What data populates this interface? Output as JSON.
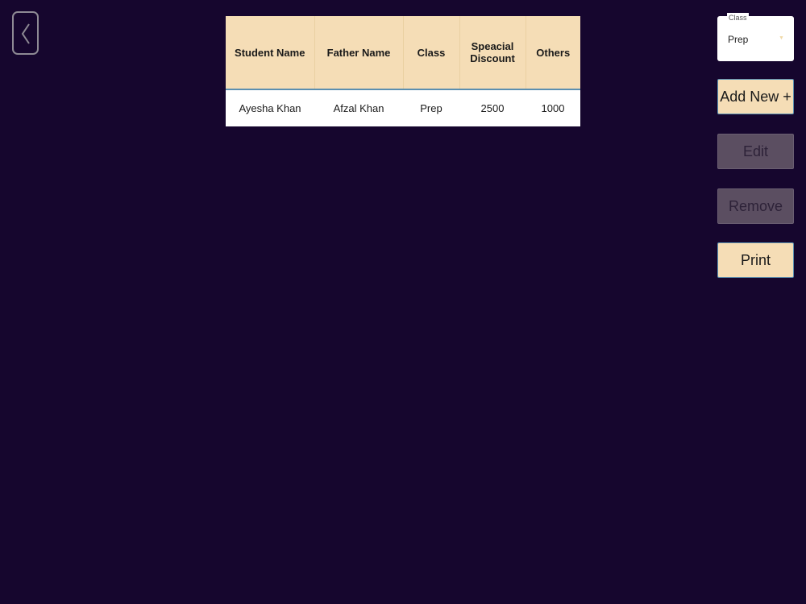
{
  "table": {
    "headers": [
      "Student Name",
      "Father Name",
      "Class",
      "Speacial Discount",
      "Others"
    ],
    "rows": [
      [
        "Ayesha Khan",
        "Afzal Khan",
        "Prep",
        "2500",
        "1000"
      ]
    ]
  },
  "class_filter": {
    "label": "Class",
    "value": "Prep"
  },
  "actions": {
    "add_new": "Add New +",
    "edit": "Edit",
    "remove": "Remove",
    "print": "Print"
  },
  "icons": {
    "back": "chevron-left-icon",
    "dropdown": "caret-down-icon"
  },
  "colors": {
    "background": "#16062e",
    "header_fill": "#f5ddb6",
    "disabled_button": "#5b4e61"
  }
}
